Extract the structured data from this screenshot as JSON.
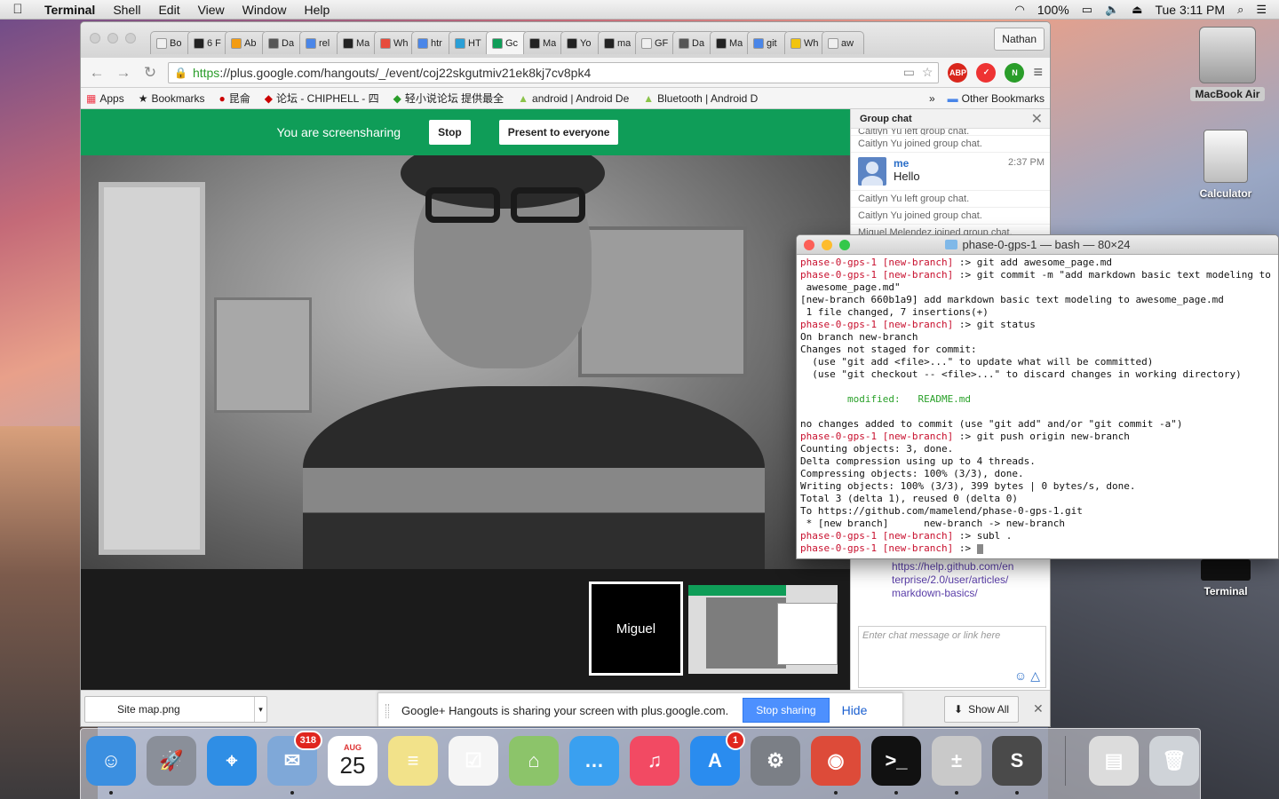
{
  "menubar": {
    "app_name": "Terminal",
    "menus": [
      "Shell",
      "Edit",
      "View",
      "Window",
      "Help"
    ],
    "battery": "100%",
    "clock": "Tue 3:11 PM"
  },
  "chrome": {
    "tabs": [
      {
        "label": "Bo",
        "color": "#f0f0f0"
      },
      {
        "label": "6 F",
        "color": "#222222"
      },
      {
        "label": "Ab",
        "color": "#f39c12"
      },
      {
        "label": "Da",
        "color": "#555555"
      },
      {
        "label": "rel",
        "color": "#4a86e8"
      },
      {
        "label": "Ma",
        "color": "#222222"
      },
      {
        "label": "Wh",
        "color": "#e74c3c"
      },
      {
        "label": "htr",
        "color": "#4a86e8"
      },
      {
        "label": "HT",
        "color": "#2a9fd6"
      },
      {
        "label": "Gc",
        "color": "#0f9d58"
      },
      {
        "label": "Ma",
        "color": "#222222"
      },
      {
        "label": "Yo",
        "color": "#222222"
      },
      {
        "label": "ma",
        "color": "#222222"
      },
      {
        "label": "GF",
        "color": "#f0f0f0"
      },
      {
        "label": "Da",
        "color": "#555555"
      },
      {
        "label": "Ma",
        "color": "#222222"
      },
      {
        "label": "git",
        "color": "#4a86e8"
      },
      {
        "label": "Wh",
        "color": "#f1c40f"
      },
      {
        "label": "aw",
        "color": "#f0f0f0"
      }
    ],
    "profile": "Nathan",
    "url_https": "https",
    "url_rest": "://plus.google.com/hangouts/_/event/coj22skgutmiv21ek8kj7cv8pk4",
    "bookmarks": [
      "Apps",
      "Bookmarks",
      "昆侖",
      "论坛 - CHIPHELL - 四",
      "轻小说论坛 提供最全",
      "android | Android De",
      "Bluetooth | Android D"
    ],
    "other_bookmarks": "Other Bookmarks"
  },
  "hangouts": {
    "sharing_msg": "You are screensharing",
    "stop_label": "Stop",
    "present_label": "Present to everyone",
    "participant_name": "Miguel"
  },
  "chat": {
    "title": "Group chat",
    "top_cut": "Caitlyn Yu left group chat.",
    "events_before": [
      "Caitlyn Yu joined group chat."
    ],
    "message": {
      "sender": "me",
      "time": "2:37 PM",
      "text": "Hello"
    },
    "events_after": [
      "Caitlyn Yu left group chat.",
      "Caitlyn Yu joined group chat.",
      "Miguel Melendez joined group chat."
    ],
    "link_lines": [
      "https://help.github.com/en",
      "terprise/2.0/user/articles/",
      "markdown-basics/"
    ],
    "input_placeholder": "Enter chat message or link here"
  },
  "shelf": {
    "download_file": "Site map.png",
    "share_message": "Google+ Hangouts is sharing your screen with plus.google.com.",
    "stop_sharing": "Stop sharing",
    "hide": "Hide",
    "show_all": "Show All"
  },
  "terminal": {
    "title": "phase-0-gps-1 — bash — 80×24",
    "prompt": "phase-0-gps-1",
    "branch": "[new-branch]",
    "lines": [
      {
        "kind": "cmd",
        "text": ":> git add awesome_page.md"
      },
      {
        "kind": "cmd",
        "text": ":> git commit -m \"add markdown basic text modeling to"
      },
      {
        "kind": "out",
        "text": " awesome_page.md\""
      },
      {
        "kind": "out",
        "text": "[new-branch 660b1a9] add markdown basic text modeling to awesome_page.md"
      },
      {
        "kind": "out",
        "text": " 1 file changed, 7 insertions(+)"
      },
      {
        "kind": "cmd",
        "text": ":> git status"
      },
      {
        "kind": "out",
        "text": "On branch new-branch"
      },
      {
        "kind": "out",
        "text": "Changes not staged for commit:"
      },
      {
        "kind": "out",
        "text": "  (use \"git add <file>...\" to update what will be committed)"
      },
      {
        "kind": "out",
        "text": "  (use \"git checkout -- <file>...\" to discard changes in working directory)"
      },
      {
        "kind": "out",
        "text": ""
      },
      {
        "kind": "mod",
        "text": "        modified:   README.md"
      },
      {
        "kind": "out",
        "text": ""
      },
      {
        "kind": "out",
        "text": "no changes added to commit (use \"git add\" and/or \"git commit -a\")"
      },
      {
        "kind": "cmd",
        "text": ":> git push origin new-branch"
      },
      {
        "kind": "out",
        "text": "Counting objects: 3, done."
      },
      {
        "kind": "out",
        "text": "Delta compression using up to 4 threads."
      },
      {
        "kind": "out",
        "text": "Compressing objects: 100% (3/3), done."
      },
      {
        "kind": "out",
        "text": "Writing objects: 100% (3/3), 399 bytes | 0 bytes/s, done."
      },
      {
        "kind": "out",
        "text": "Total 3 (delta 1), reused 0 (delta 0)"
      },
      {
        "kind": "out",
        "text": "To https://github.com/mamelend/phase-0-gps-1.git"
      },
      {
        "kind": "out",
        "text": " * [new branch]      new-branch -> new-branch"
      },
      {
        "kind": "cmd",
        "text": ":> subl ."
      },
      {
        "kind": "cmd",
        "text": ":> "
      }
    ]
  },
  "desktop": {
    "hdd_label": "MacBook Air",
    "calc_label": "Calculator",
    "term_label": "Terminal"
  },
  "dock": {
    "apps": [
      {
        "name": "finder",
        "glyph": "☺",
        "bg": "#3b8fe0",
        "running": true
      },
      {
        "name": "launchpad",
        "glyph": "🚀",
        "bg": "#8a8f99",
        "running": false
      },
      {
        "name": "safari",
        "glyph": "⌖",
        "bg": "#2f8ee5",
        "running": false
      },
      {
        "name": "mail",
        "glyph": "✉",
        "bg": "#7fa8d8",
        "running": true,
        "badge": "318"
      },
      {
        "name": "calendar",
        "glyph": "25",
        "bg": "#ffffff",
        "running": false,
        "month": "AUG"
      },
      {
        "name": "notes",
        "glyph": "≡",
        "bg": "#f2e28a",
        "running": false
      },
      {
        "name": "reminders",
        "glyph": "☑",
        "bg": "#f5f5f5",
        "running": false
      },
      {
        "name": "maps",
        "glyph": "⌂",
        "bg": "#8cc46a",
        "running": false
      },
      {
        "name": "messages",
        "glyph": "…",
        "bg": "#3aa0f0",
        "running": false
      },
      {
        "name": "itunes",
        "glyph": "♫",
        "bg": "#f24a63",
        "running": false
      },
      {
        "name": "app-store",
        "glyph": "A",
        "bg": "#2a8cef",
        "running": false,
        "badge": "1"
      },
      {
        "name": "system-preferences",
        "glyph": "⚙",
        "bg": "#7b7f86",
        "running": false
      },
      {
        "name": "chrome",
        "glyph": "◉",
        "bg": "#dd4b39",
        "running": true
      },
      {
        "name": "terminal",
        "glyph": ">_",
        "bg": "#111111",
        "running": true
      },
      {
        "name": "calculator",
        "glyph": "±",
        "bg": "#c9c9c9",
        "running": true
      },
      {
        "name": "sublime-text",
        "glyph": "S",
        "bg": "#4a4a4a",
        "running": true
      }
    ],
    "right_apps": [
      {
        "name": "preview-doc",
        "glyph": "▤",
        "bg": "#dcdcdc"
      },
      {
        "name": "trash",
        "glyph": "🗑",
        "bg": "#cfd3d8"
      }
    ]
  }
}
